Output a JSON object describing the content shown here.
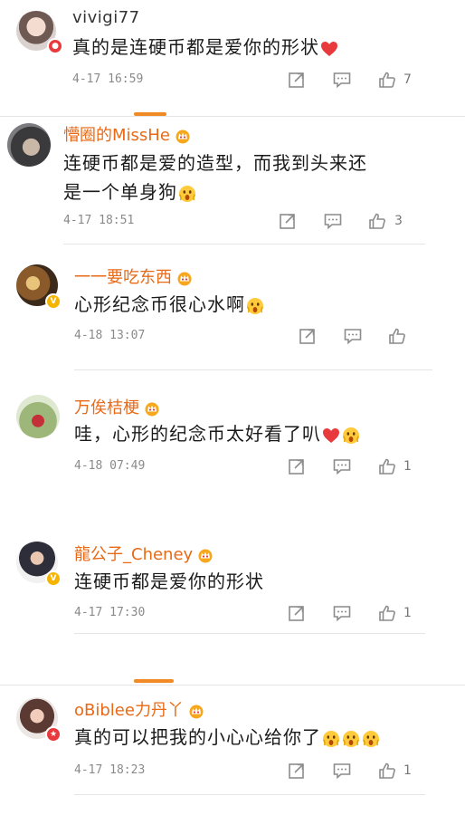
{
  "comments": [
    {
      "name": "vivigi77",
      "text": "真的是连硬币都是爱你的形状",
      "time": "4-17 16:59",
      "likes": "7"
    },
    {
      "name": "懵圈的MissHe",
      "text_line1": "连硬币都是爱的造型，而我到头来还",
      "text_line2": "是一个单身狗",
      "time": "4-17 18:51",
      "likes": "3"
    },
    {
      "name": "一一要吃东西",
      "text": "心形纪念币很心水啊",
      "time": "4-18 13:07",
      "likes": ""
    },
    {
      "name": "万俟桔梗",
      "text": "哇，心形的纪念币太好看了叭",
      "time": "4-18 07:49",
      "likes": "1"
    },
    {
      "name": "龍公子_Cheney",
      "text": "连硬币都是爱你的形状",
      "time": "4-17 17:30",
      "likes": "1"
    },
    {
      "name": "oBiblee力丹丫",
      "text": "真的可以把我的小心心给你了",
      "time": "4-17 18:23",
      "likes": "1"
    }
  ],
  "icons": {
    "repost": "share-square-icon",
    "comment": "comment-bubble-icon",
    "like": "thumbs-up-icon",
    "vip": "crown-badge-icon",
    "heart": "red-heart-emoji",
    "surprised": "surprised-face-emoji"
  },
  "colors": {
    "vip_name": "#e86a17",
    "normal_name": "#333333",
    "accent": "#f08a24",
    "time": "#8a8a8a"
  }
}
